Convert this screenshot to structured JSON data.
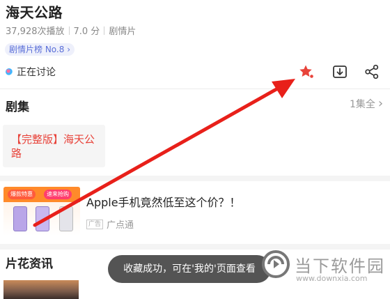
{
  "video": {
    "title": "海天公路",
    "plays": "37,928次播放",
    "rating": "7.0 分",
    "genre": "剧情片",
    "rank_tag": "剧情片榜 No.8",
    "rank_chevron": "›",
    "discussing": "正在讨论"
  },
  "actions": {
    "favorite_icon": "star-icon",
    "download_icon": "download-icon",
    "share_icon": "share-icon",
    "favorite_color": "#e8433a"
  },
  "episodes": {
    "section_title": "剧集",
    "count": "1集全",
    "count_chevron": "›",
    "items": [
      {
        "label": "【完整版】海天公路"
      }
    ]
  },
  "ad": {
    "title": "Apple手机竟然低至这个价？！",
    "badge": "广告",
    "source": "广点通",
    "banner_left": "爆款特惠",
    "banner_right": "速来抢购"
  },
  "news": {
    "section_title": "片花资讯"
  },
  "toast": {
    "message": "收藏成功，可在'我的'页面查看"
  },
  "watermark": {
    "name": "当下软件园",
    "url": "www.downxia.com"
  },
  "colors": {
    "accent_red": "#e8433a",
    "annotation_arrow": "#e8201a",
    "tag_blue": "#5a6fd8"
  }
}
